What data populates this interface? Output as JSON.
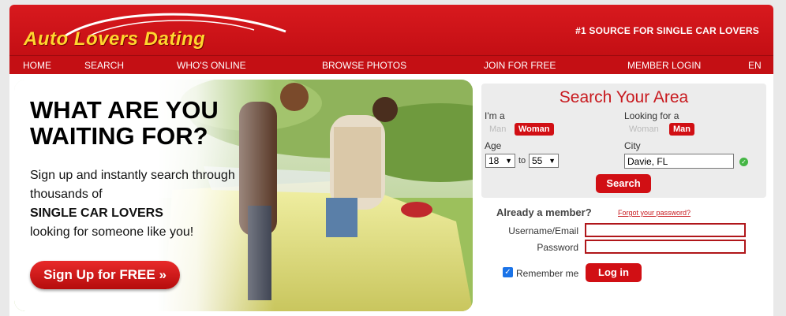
{
  "header": {
    "logo": "Auto Lovers Dating",
    "tagline": "#1 SOURCE FOR SINGLE CAR LOVERS"
  },
  "nav": {
    "items": [
      "HOME",
      "SEARCH",
      "WHO'S ONLINE",
      "BROWSE PHOTOS",
      "JOIN FOR FREE",
      "MEMBER LOGIN"
    ],
    "language": "EN"
  },
  "hero": {
    "headline": "WHAT ARE YOU WAITING FOR?",
    "copy_line1": "Sign up and instantly search through thousands of",
    "copy_bold": "SINGLE CAR LOVERS",
    "copy_line2": "looking for someone like you!",
    "signup_label": "Sign Up for FREE »"
  },
  "search": {
    "title": "Search Your Area",
    "im_a_label": "I'm a",
    "im_a_options": [
      "Man",
      "Woman"
    ],
    "im_a_selected": "Woman",
    "looking_for_label": "Looking for a",
    "looking_for_options": [
      "Woman",
      "Man"
    ],
    "looking_for_selected": "Man",
    "age_label": "Age",
    "age_min": "18",
    "age_to": "to",
    "age_max": "55",
    "city_label": "City",
    "city_value": "Davie, FL",
    "search_button": "Search"
  },
  "login": {
    "title": "Already a member?",
    "forgot": "Forgot your password?",
    "username_label": "Username/Email",
    "password_label": "Password",
    "remember_label": "Remember me",
    "login_button": "Log in"
  },
  "colors": {
    "brand_red": "#c40f14",
    "logo_yellow": "#ffd62e",
    "check_green": "#45b645"
  }
}
